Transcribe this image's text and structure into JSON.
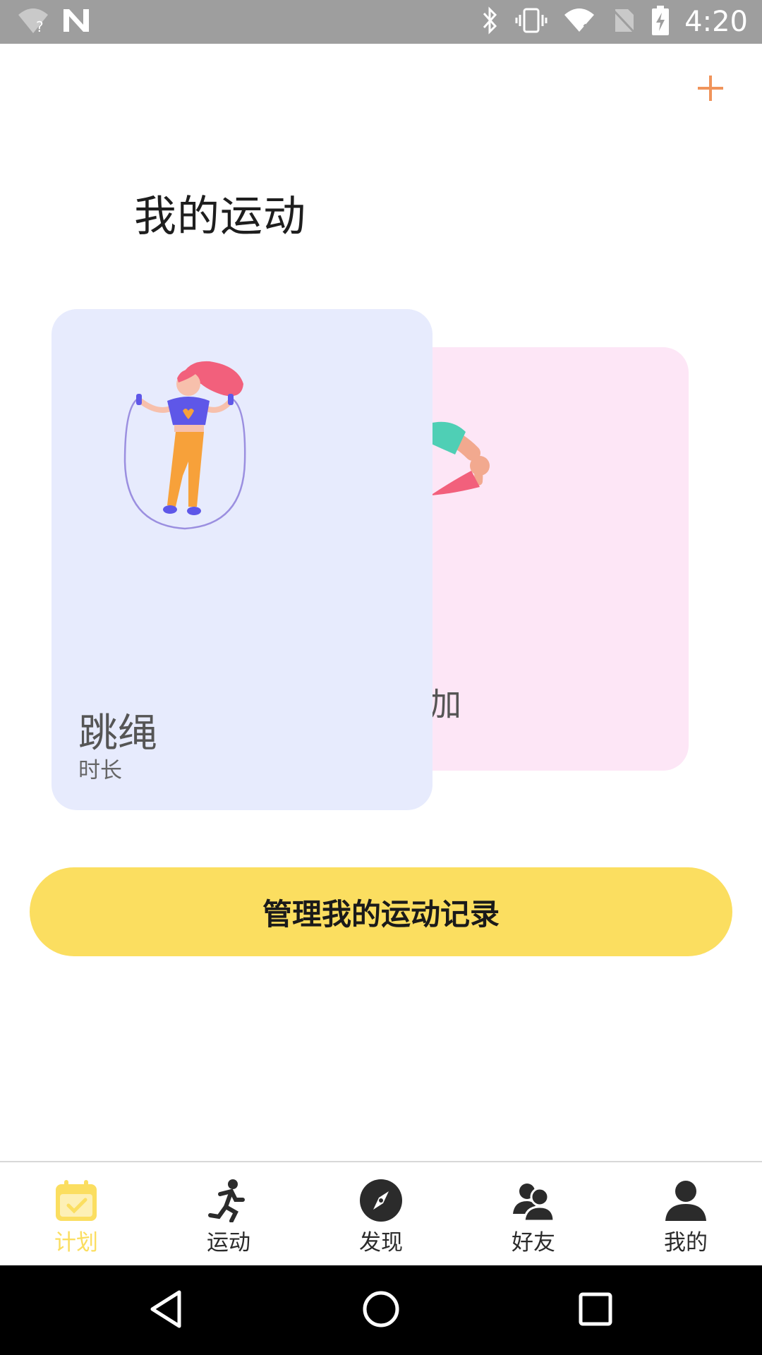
{
  "status_bar": {
    "time": "4:20",
    "left_icons": [
      "wifi-unknown-icon",
      "n-logo-icon"
    ],
    "right_icons": [
      "bluetooth-icon",
      "vibrate-icon",
      "wifi-off-icon",
      "no-sim-icon",
      "battery-charging-icon"
    ]
  },
  "header": {
    "add_icon": "plus-icon",
    "title": "我的运动"
  },
  "cards": [
    {
      "title": "跳绳",
      "subtitle": "时长",
      "color": "#e7ebfd",
      "illustration": "jump-rope-illustration"
    },
    {
      "title": "瑜伽",
      "visible_title": "加",
      "color": "#fde6f6",
      "illustration": "yoga-illustration"
    }
  ],
  "manage_button": {
    "label": "管理我的运动记录",
    "color": "#fbde60"
  },
  "bottom_nav": {
    "items": [
      {
        "label": "计划",
        "icon": "calendar-check-icon",
        "active": true
      },
      {
        "label": "运动",
        "icon": "running-icon",
        "active": false
      },
      {
        "label": "发现",
        "icon": "compass-icon",
        "active": false
      },
      {
        "label": "好友",
        "icon": "friends-icon",
        "active": false
      },
      {
        "label": "我的",
        "icon": "person-icon",
        "active": false
      }
    ],
    "active_color": "#fbde60"
  },
  "system_nav": [
    "back-icon",
    "home-icon",
    "recents-icon"
  ],
  "accent_color": "#f0945b"
}
